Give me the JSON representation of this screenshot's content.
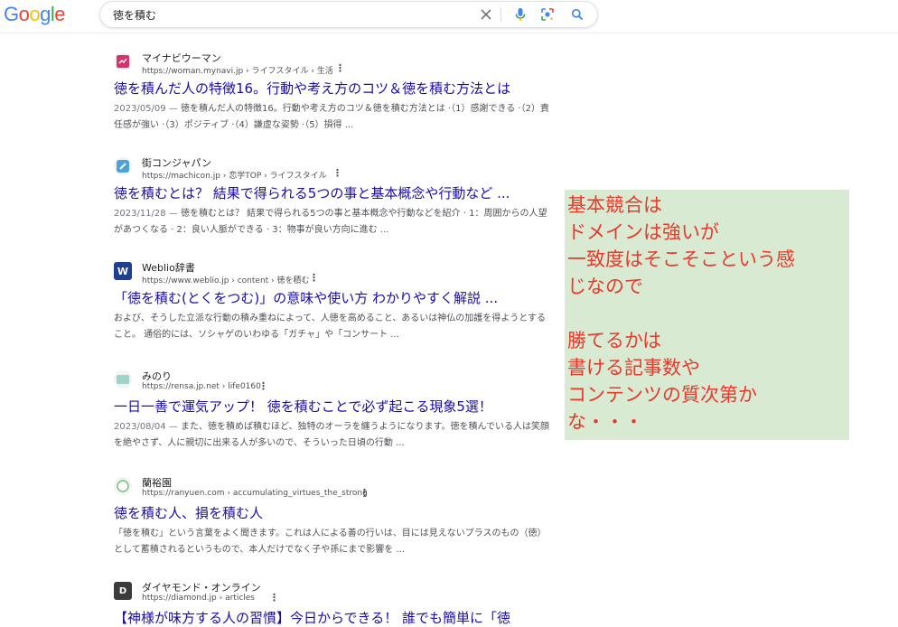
{
  "logo": {
    "letters": [
      "G",
      "o",
      "o",
      "g",
      "l",
      "e"
    ],
    "colors": [
      "#4285f4",
      "#ea4335",
      "#fbbc05",
      "#4285f4",
      "#34a853",
      "#ea4335"
    ]
  },
  "search": {
    "query": "徳を積む"
  },
  "icons": {
    "clear": "close-icon",
    "voice": "microphone-icon",
    "lens": "camera-lens-icon",
    "search": "search-icon"
  },
  "results": [
    {
      "site": "マイナビウーマン",
      "url": "https://woman.mynavi.jp › ライフスタイル › 生活",
      "title": "徳を積んだ人の特徴16。行動や考え方のコツ＆徳を積む方法とは",
      "date": "2023/05/09 — ",
      "snippet": "徳を積んだ人の特徴16。行動や考え方のコツ＆徳を積む方法とは ·（1）感謝できる ·（2）責任感が強い ·（3）ポジティブ ·（4）謙虚な姿勢 ·（5）損得 ...",
      "favicon_color": "#d6336c"
    },
    {
      "site": "街コンジャパン",
      "url": "https://machicon.jp › 恋学TOP › ライフスタイル",
      "title": "徳を積むとは？ 結果で得られる5つの事と基本概念や行動など ...",
      "date": "2023/11/28 — ",
      "snippet": "徳を積むとは？ 結果で得られる5つの事と基本概念や行動などを紹介 · 1：周囲からの人望があつくなる · 2：良い人脈ができる · 3：物事が良い方向に進む ...",
      "favicon_color": "#4aa3df"
    },
    {
      "site": "Weblio辞書",
      "url": "https://www.weblio.jp › content › 徳を積む",
      "title": "「徳を積む(とくをつむ)」の意味や使い方 わかりやすく解説 ...",
      "date": "",
      "snippet": "および、そうした立派な行動の積み重ねによって、人徳を高めること、あるいは神仏の加護を得ようとすること。 通俗的には、ソシャゲのいわゆる「ガチャ」や「コンサート ...",
      "favicon_color": "#1f3f8f"
    },
    {
      "site": "みのり",
      "url": "https://rensa.jp.net › life0160",
      "title": "一日一善で運気アップ！ 徳を積むことで必ず起こる現象5選！",
      "date": "2023/08/04 — ",
      "snippet": "また、徳を積めば積むほど、独特のオーラを纏うようになります。徳を積んでいる人は笑顔を絶やさず、人に親切に出来る人が多いので、そういった日頃の行動 ...",
      "favicon_color": "#9fd3c7"
    },
    {
      "site": "蘭裕園",
      "url": "https://ranyuen.com › accumulating_virtues_the_strong",
      "title": "徳を積む人、損を積む人",
      "date": "",
      "snippet": "「徳を積む」という言葉をよく聞きます。これは人による善の行いは、目には見えないプラスのもの（徳）として蓄積されるというもので、本人だけでなく子や孫にまで影響を ...",
      "favicon_color": "#6fbf73"
    },
    {
      "site": "ダイヤモンド・オンライン",
      "url": "https://diamond.jp › articles",
      "title": "【神様が味方する人の習慣】今日からできる！ 誰でも簡単に「徳",
      "date": "",
      "snippet": "",
      "favicon_color": "#3b3b3b"
    }
  ],
  "note": {
    "lines": [
      "基本競合は",
      "ドメインは強いが",
      "一致度はそこそこという感",
      "じなので",
      "",
      "勝てるかは",
      "書ける記事数や",
      "コンテンツの質次第か",
      "な・・・"
    ],
    "bg": "#d9ead3",
    "text_color": "#e8392b"
  }
}
